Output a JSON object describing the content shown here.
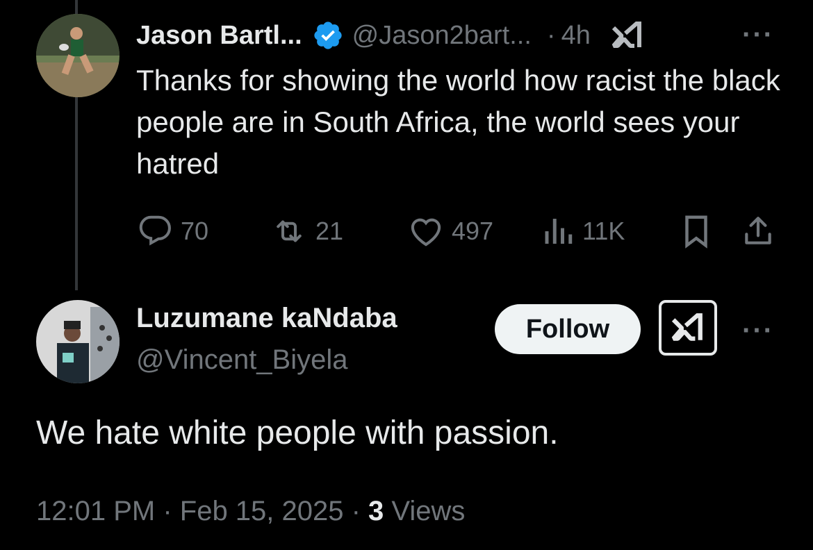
{
  "reply": {
    "display_name": "Jason Bartl...",
    "handle": "@Jason2bart...",
    "separator": "·",
    "time": "4h",
    "more_label": "···",
    "text": "Thanks for showing the world how racist the black people are in South Africa, the world sees your hatred",
    "actions": {
      "replies": "70",
      "reposts": "21",
      "likes": "497",
      "views": "11K"
    }
  },
  "main_post": {
    "display_name": "Luzumane kaNdaba",
    "handle": "@Vincent_Biyela",
    "follow_label": "Follow",
    "more_label": "···",
    "text": "We hate white people with passion.",
    "timestamp": "12:01 PM · Feb 15, 2025 · ",
    "view_count": "3",
    "views_label": " Views"
  },
  "icons": {
    "verified": "verified-badge-icon",
    "grok": "grok-icon",
    "reply": "reply-icon",
    "repost": "repost-icon",
    "like": "heart-icon",
    "views": "analytics-icon",
    "bookmark": "bookmark-icon",
    "share": "share-icon"
  },
  "colors": {
    "background": "#000000",
    "text": "#e7e9ea",
    "secondary": "#71767b",
    "verified": "#1d9bf0",
    "follow_bg": "#eff3f4"
  }
}
